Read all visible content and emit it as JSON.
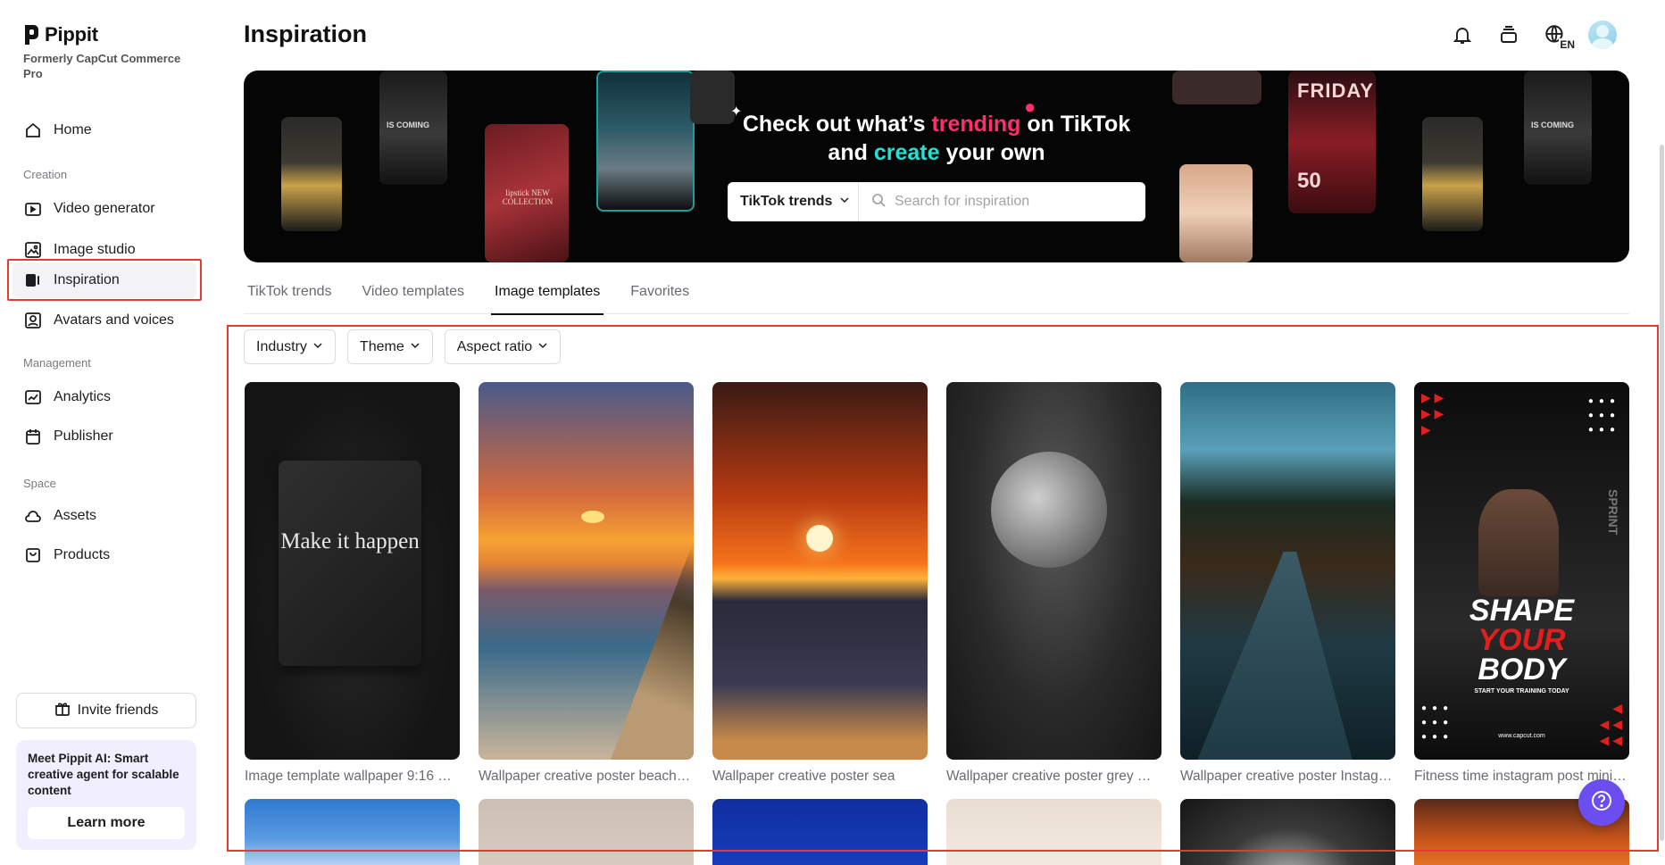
{
  "brand": {
    "name": "Pippit",
    "subtitle": "Formerly CapCut Commerce Pro"
  },
  "sidebar": {
    "home": "Home",
    "section_creation": "Creation",
    "video_generator": "Video generator",
    "image_studio": "Image studio",
    "inspiration": "Inspiration",
    "avatars_voices": "Avatars and voices",
    "section_management": "Management",
    "analytics": "Analytics",
    "publisher": "Publisher",
    "section_space": "Space",
    "assets": "Assets",
    "products": "Products",
    "invite": "Invite friends",
    "promo_text": "Meet Pippit AI: Smart creative agent for scalable content",
    "promo_button": "Learn more"
  },
  "header": {
    "title": "Inspiration",
    "lang_badge": "EN"
  },
  "banner": {
    "line1_a": "Check out what’s ",
    "line1_highlight": "trending",
    "line1_b": " on TikTok",
    "line2_a": "and ",
    "line2_highlight": "create",
    "line2_b": " your own",
    "select_label": "TikTok trends",
    "search_placeholder": "Search for inspiration",
    "card_text_coming": "IS COMING",
    "card_text_friday": "FRIDAY",
    "card_text_lipstick": "lipstick NEW COLLECTION",
    "card_text_50": "50"
  },
  "tabs": [
    "TikTok trends",
    "Video templates",
    "Image templates",
    "Favorites"
  ],
  "filters": [
    "Industry",
    "Theme",
    "Aspect ratio"
  ],
  "templates": [
    {
      "caption": "Image template wallpaper 9:16 …",
      "overlay": "Make it happen"
    },
    {
      "caption": "Wallpaper creative poster beach…"
    },
    {
      "caption": "Wallpaper creative poster sea"
    },
    {
      "caption": "Wallpaper creative poster grey …"
    },
    {
      "caption": "Wallpaper creative poster Instag…"
    },
    {
      "caption": "Fitness time instagram post mini…",
      "overlay_1": "SHAPE",
      "overlay_2": "YOUR",
      "overlay_3": "BODY",
      "overlay_4": "START YOUR TRAINING TODAY",
      "overlay_5": "www.capcut.com",
      "overlay_6": "SPRINT"
    }
  ],
  "colors": {
    "accent_pink": "#ff2f6e",
    "accent_teal": "#22e0d2",
    "help_purple": "#6b4ef0",
    "highlight_red": "#e53935"
  }
}
